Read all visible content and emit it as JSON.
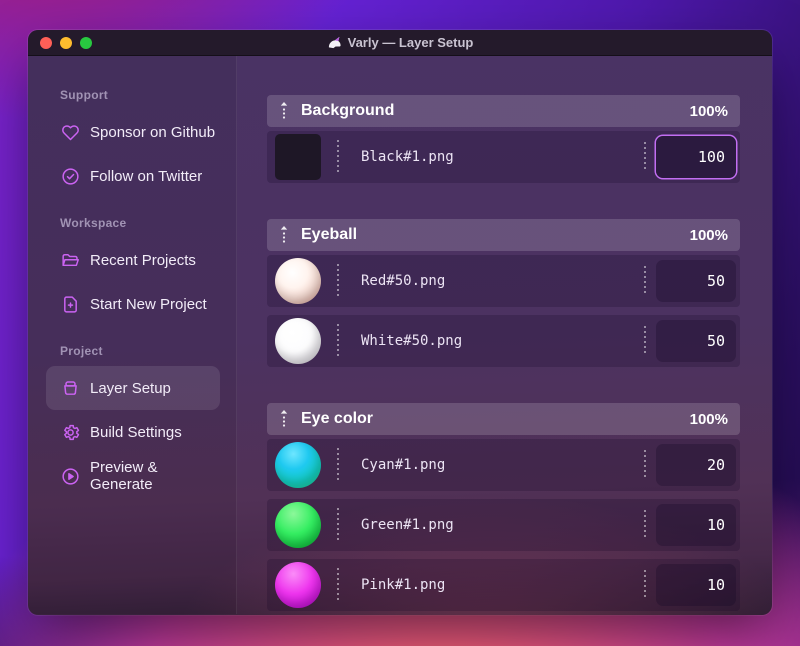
{
  "window": {
    "title": "Varly — Layer Setup",
    "app_icon": "unicorn-icon",
    "traffic_lights": {
      "close": "#ff5f57",
      "minimize": "#febc2e",
      "zoom": "#28c840"
    }
  },
  "sidebar": {
    "sections": [
      {
        "label": "Support",
        "items": [
          {
            "icon": "heart-icon",
            "label": "Sponsor on Github",
            "selected": false
          },
          {
            "icon": "verified-check-icon",
            "label": "Follow on Twitter",
            "selected": false
          }
        ]
      },
      {
        "label": "Workspace",
        "items": [
          {
            "icon": "folder-icon",
            "label": "Recent Projects",
            "selected": false
          },
          {
            "icon": "document-plus-icon",
            "label": "Start New Project",
            "selected": false
          }
        ]
      },
      {
        "label": "Project",
        "items": [
          {
            "icon": "layers-bag-icon",
            "label": "Layer Setup",
            "selected": true
          },
          {
            "icon": "gear-icon",
            "label": "Build Settings",
            "selected": false
          },
          {
            "icon": "play-circle-icon",
            "label": "Preview & Generate",
            "selected": false
          }
        ]
      }
    ]
  },
  "layers": {
    "groups": [
      {
        "name": "Background",
        "weight": "100%",
        "items": [
          {
            "file": "Black#1.png",
            "value": "100",
            "thumb": "black-square",
            "focused": true
          }
        ]
      },
      {
        "name": "Eyeball",
        "weight": "100%",
        "items": [
          {
            "file": "Red#50.png",
            "value": "50",
            "thumb": "red-sphere",
            "focused": false
          },
          {
            "file": "White#50.png",
            "value": "50",
            "thumb": "white-sphere",
            "focused": false
          }
        ]
      },
      {
        "name": "Eye color",
        "weight": "100%",
        "items": [
          {
            "file": "Cyan#1.png",
            "value": "20",
            "thumb": "cyan-sphere",
            "focused": false
          },
          {
            "file": "Green#1.png",
            "value": "10",
            "thumb": "green-sphere",
            "focused": false
          },
          {
            "file": "Pink#1.png",
            "value": "10",
            "thumb": "pink-sphere",
            "focused": false
          }
        ]
      }
    ]
  },
  "colors": {
    "accent": "#cb63f2",
    "input_focus_border": "#c26ef2",
    "titlebar_bg": "#241a2b",
    "window_bg_top": "#4a3364",
    "group_header_bg": "rgba(255,255,255,0.16)"
  }
}
